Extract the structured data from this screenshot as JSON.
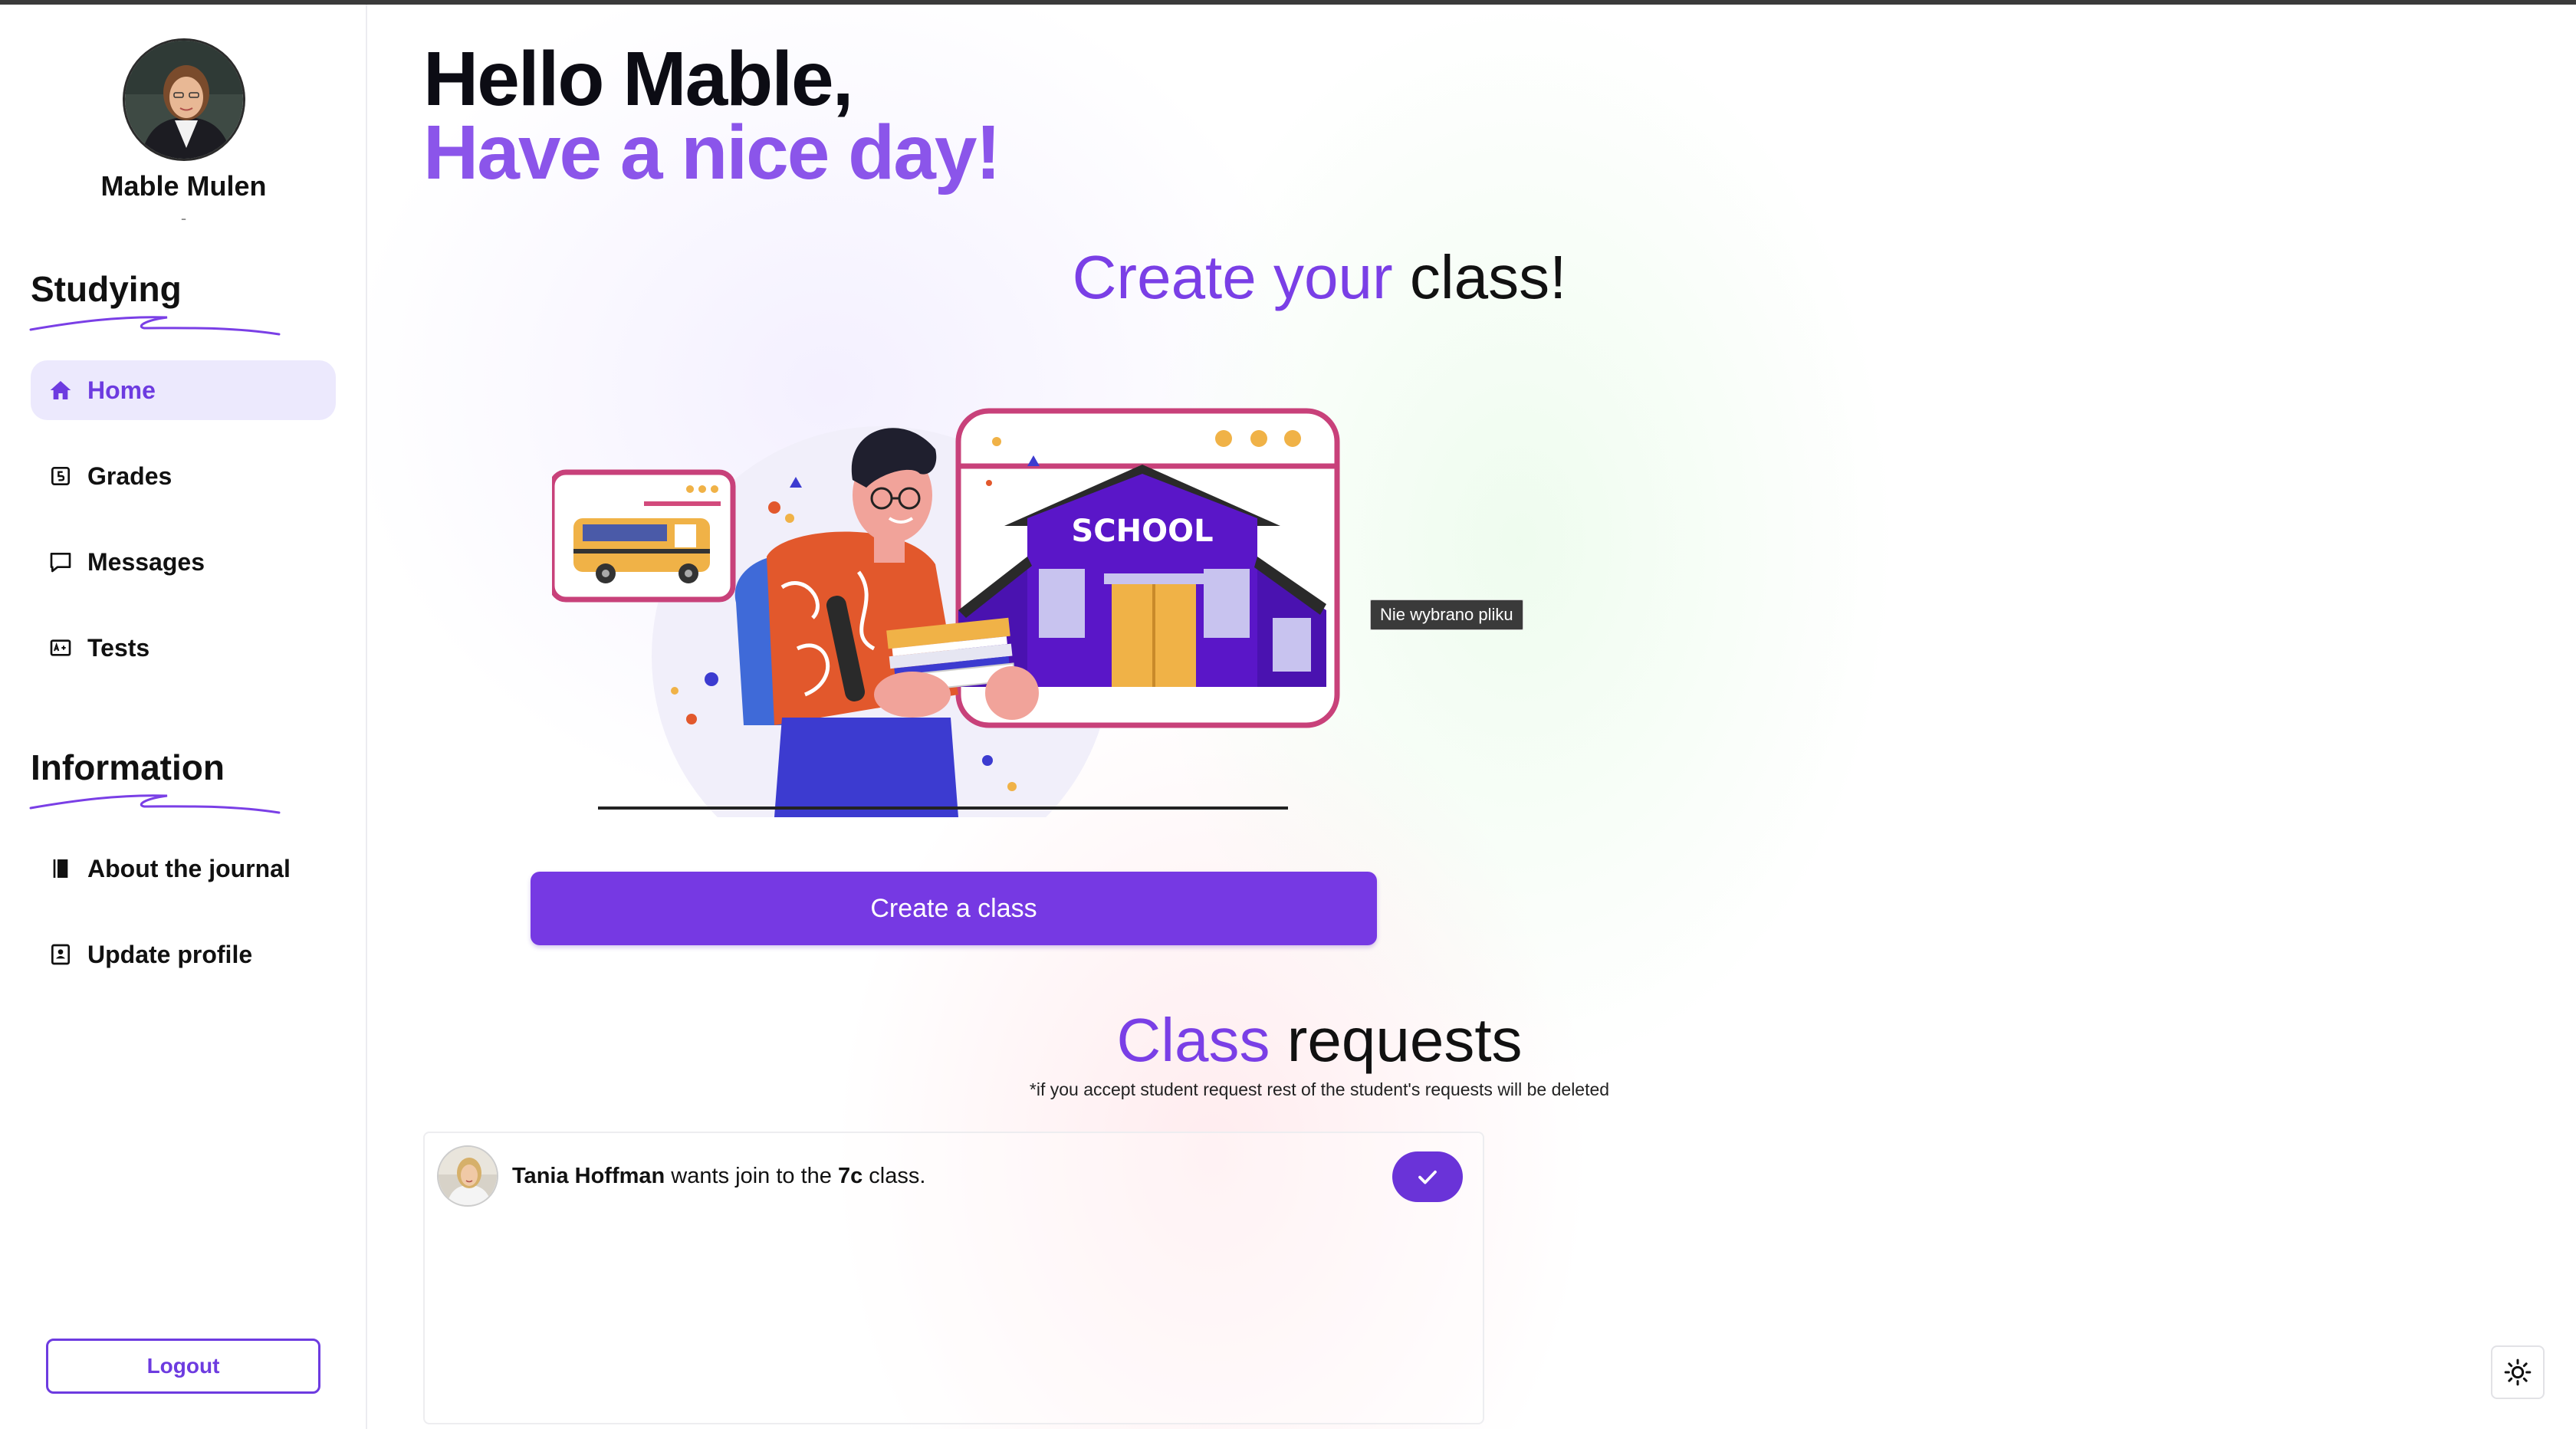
{
  "user": {
    "name": "Mable Mulen",
    "subtitle": "-"
  },
  "sidebar": {
    "sections": [
      {
        "title": "Studying",
        "items": [
          {
            "label": "Home",
            "icon": "home-icon",
            "active": true
          },
          {
            "label": "Grades",
            "icon": "grade-icon"
          },
          {
            "label": "Messages",
            "icon": "message-icon"
          },
          {
            "label": "Tests",
            "icon": "test-icon"
          }
        ]
      },
      {
        "title": "Information",
        "items": [
          {
            "label": "About the journal",
            "icon": "book-icon"
          },
          {
            "label": "Update profile",
            "icon": "profile-icon"
          }
        ]
      }
    ],
    "logout_label": "Logout"
  },
  "greeting": {
    "line1": "Hello Mable,",
    "line2": "Have a nice day!"
  },
  "create": {
    "title_accent": "Create your",
    "title_rest": " class!",
    "file_tooltip": "Nie wybrano pliku",
    "button_label": "Create a class",
    "illustration_sign": "SCHOOL"
  },
  "requests": {
    "title_accent": "Class",
    "title_rest": " requests",
    "note": "*if you accept student request rest of the student's requests will be deleted",
    "items": [
      {
        "student": "Tania Hoffman",
        "middle": " wants join to the ",
        "class": "7c",
        "end": " class."
      }
    ]
  },
  "colors": {
    "accent": "#7639e3",
    "accent_light": "#ece9fd",
    "greeting_accent": "#8b55ea"
  }
}
